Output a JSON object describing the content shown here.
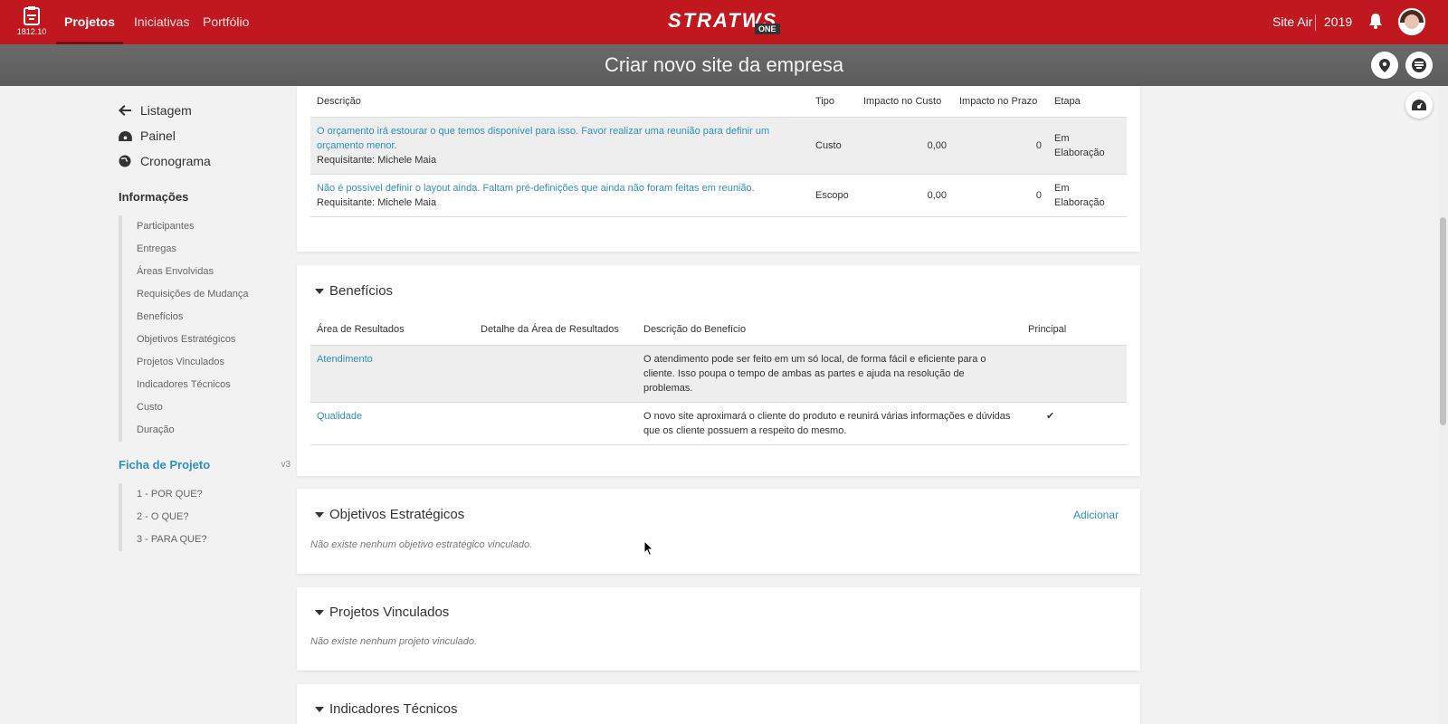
{
  "topbar": {
    "version": "1812.10",
    "nav": [
      "Projetos",
      "Iniciativas",
      "Portfólio"
    ],
    "brand": "STRATWS",
    "brand_suffix": "ONE",
    "site": "Site Air",
    "year": "2019",
    "icons": [
      "clipboard-icon",
      "bell-icon",
      "avatar"
    ],
    "accent_color": "#c0181e"
  },
  "titlebar": {
    "title": "Criar novo site da empresa",
    "icons": [
      "map-pin-icon",
      "stratws-menu-icon"
    ]
  },
  "sidebar": {
    "links": [
      {
        "label": "Listagem",
        "icon": "arrow-left-icon"
      },
      {
        "label": "Painel",
        "icon": "dashboard-icon"
      },
      {
        "label": "Cronograma",
        "icon": "globe-icon"
      }
    ],
    "info_heading": "Informações",
    "info_items": [
      "Participantes",
      "Entregas",
      "Áreas Envolvidas",
      "Requisições de Mudança",
      "Benefícios",
      "Objetivos Estratégicos",
      "Projetos Vinculados",
      "Indicadores Técnicos",
      "Custo",
      "Duração"
    ],
    "ficha_heading": "Ficha de Projeto",
    "ficha_version": "v3",
    "ficha_items": [
      "1 - POR QUE?",
      "2 - O QUE?",
      "3 - PARA QUE?"
    ]
  },
  "changes": {
    "headers": [
      "Descrição",
      "Tipo",
      "Impacto no Custo",
      "Impacto no Prazo",
      "Etapa"
    ],
    "rows": [
      {
        "desc": "O orçamento irá estourar o que temos disponível para isso. Favor realizar uma reunião para definir um orçamento menor.",
        "requester": "Requisitante: Michele Maia",
        "type": "Custo",
        "cost": "0,00",
        "time": "0",
        "stage": "Em Elaboração"
      },
      {
        "desc": "Não é possível definir o layout ainda. Faltam pré-definições que ainda não foram feitas em reunião.",
        "requester": "Requisitante: Michele Maia",
        "type": "Escopo",
        "cost": "0,00",
        "time": "0",
        "stage": "Em Elaboração"
      }
    ]
  },
  "benefits": {
    "title": "Benefícios",
    "headers": [
      "Área de Resultados",
      "Detalhe da Área de Resultados",
      "Descrição do Benefício",
      "Principal"
    ],
    "rows": [
      {
        "area": "Atendimento",
        "detail": "",
        "desc": "O atendimento pode ser feito em um só local, de forma fácil e eficiente para o cliente. Isso poupa o tempo de ambas as partes e ajuda na resolução de problemas.",
        "principal": ""
      },
      {
        "area": "Qualidade",
        "detail": "",
        "desc": "O novo site aproximará o cliente do produto e reunirá várias informações e dúvidas que os cliente possuem a respeito do mesmo.",
        "principal": "✔"
      }
    ]
  },
  "objectives": {
    "title": "Objetivos Estratégicos",
    "add": "Adicionar",
    "empty": "Não existe nenhum objetivo estratégico vinculado."
  },
  "linked": {
    "title": "Projetos Vinculados",
    "empty": "Não existe nenhum projeto vinculado."
  },
  "indicators": {
    "title": "Indicadores Técnicos"
  }
}
